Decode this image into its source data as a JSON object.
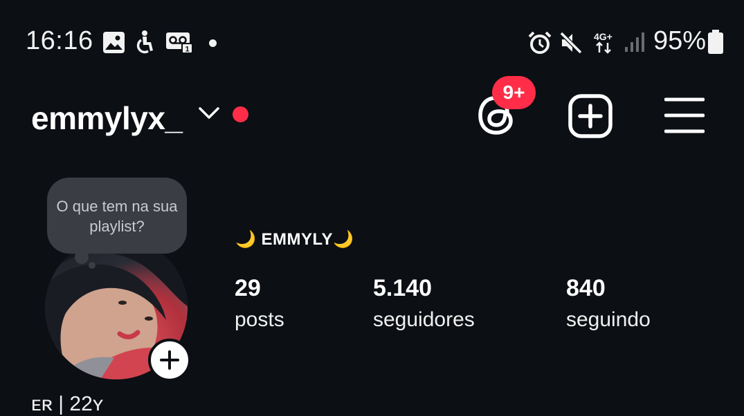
{
  "status_bar": {
    "time": "16:16",
    "battery": "95%",
    "network": "4G+",
    "icons": [
      "gallery-icon",
      "accessibility-icon",
      "voicemail-icon",
      "alarm-icon",
      "mute-icon",
      "signal-icon",
      "battery-icon"
    ]
  },
  "header": {
    "username": "emmylyx_",
    "threads_badge": "9+"
  },
  "note": {
    "text": "O que tem na sua playlist?"
  },
  "profile": {
    "display_name": "🌙 EMMYLY🌙",
    "stats": [
      {
        "value": "29",
        "label": "posts"
      },
      {
        "value": "5.140",
        "label": "seguidores"
      },
      {
        "value": "840",
        "label": "seguindo"
      }
    ],
    "bio_partial": "ᴇʀ | 22ʏ"
  },
  "colors": {
    "background": "#0c0f14",
    "accent_red": "#ff2d48",
    "note_bubble": "#3a3d43"
  }
}
